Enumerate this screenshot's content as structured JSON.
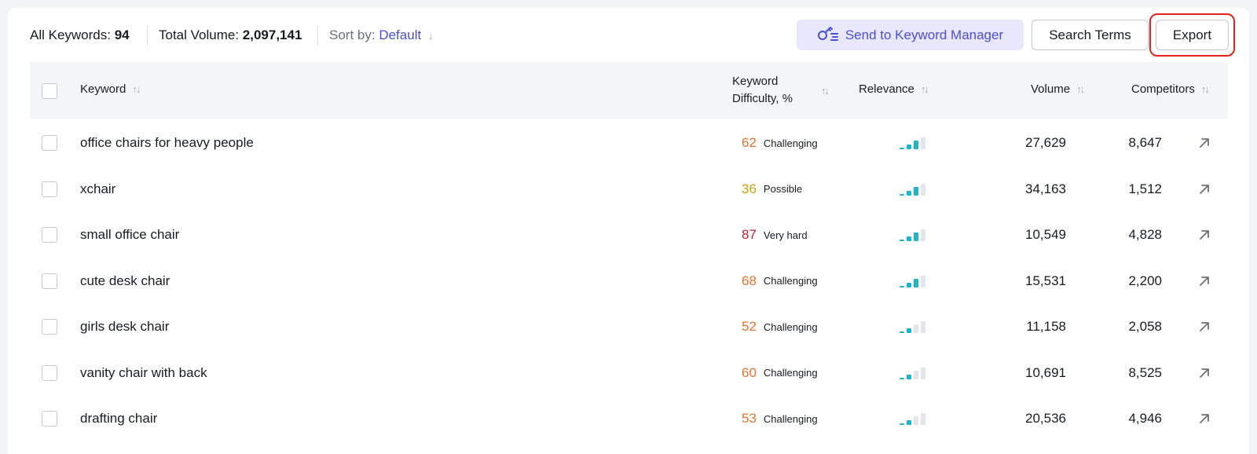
{
  "toolbar": {
    "all_keywords_label": "All Keywords:",
    "all_keywords_value": "94",
    "total_volume_label": "Total Volume:",
    "total_volume_value": "2,097,141",
    "sort_label": "Sort by:",
    "sort_value": "Default",
    "send_button": "Send to Keyword Manager",
    "search_terms_button": "Search Terms",
    "export_button": "Export"
  },
  "table": {
    "headers": {
      "keyword": "Keyword",
      "difficulty_line1": "Keyword",
      "difficulty_line2": "Difficulty, %",
      "relevance": "Relevance",
      "volume": "Volume",
      "competitors": "Competitors"
    },
    "rows": [
      {
        "keyword": "office chairs for heavy people",
        "kd": "62",
        "kd_label": "Challenging",
        "kd_color": "#e8722b",
        "relevance": 3,
        "volume": "27,629",
        "competitors": "8,647"
      },
      {
        "keyword": "xchair",
        "kd": "36",
        "kd_label": "Possible",
        "kd_color": "#d1a20e",
        "relevance": 2,
        "volume": "34,163",
        "competitors": "1,512"
      },
      {
        "keyword": "small office chair",
        "kd": "87",
        "kd_label": "Very hard",
        "kd_color": "#c81c2c",
        "relevance": 3,
        "volume": "10,549",
        "competitors": "4,828"
      },
      {
        "keyword": "cute desk chair",
        "kd": "68",
        "kd_label": "Challenging",
        "kd_color": "#e8722b",
        "relevance": 2,
        "volume": "15,531",
        "competitors": "2,200"
      },
      {
        "keyword": "girls desk chair",
        "kd": "52",
        "kd_label": "Challenging",
        "kd_color": "#e8722b",
        "relevance": 1,
        "volume": "11,158",
        "competitors": "2,058"
      },
      {
        "keyword": "vanity chair with back",
        "kd": "60",
        "kd_label": "Challenging",
        "kd_color": "#e8722b",
        "relevance": 1,
        "volume": "10,691",
        "competitors": "8,525"
      },
      {
        "keyword": "drafting chair",
        "kd": "53",
        "kd_label": "Challenging",
        "kd_color": "#e8722b",
        "relevance": 1,
        "volume": "20,536",
        "competitors": "4,946"
      }
    ]
  },
  "colors": {
    "accent": "#4a4fd9",
    "accent_bg": "#e9e7fd",
    "relevance_on": "#1fb5c9",
    "relevance_off": "#e3e5ec",
    "export_highlight": "#e0241b"
  },
  "icons": {
    "send": "keyword-manager-icon",
    "sort": "sort-arrows-icon",
    "external": "arrow-up-right-icon"
  }
}
